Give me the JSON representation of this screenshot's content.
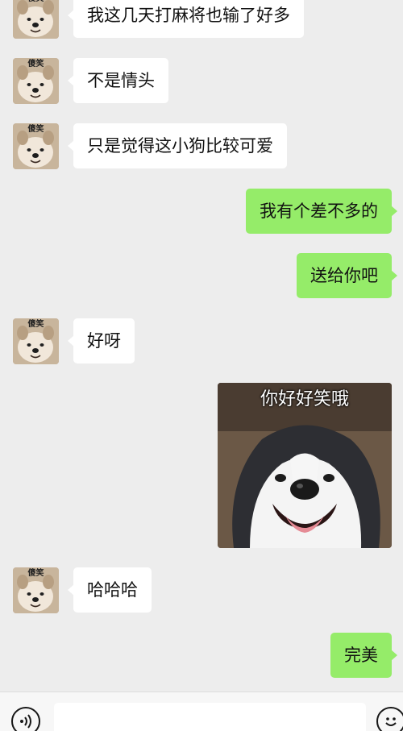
{
  "contact": {
    "avatar_label": "傻笑"
  },
  "messages": [
    {
      "side": "left",
      "text": "我这几天打麻将也输了好多"
    },
    {
      "side": "left",
      "text": "不是情头"
    },
    {
      "side": "left",
      "text": "只是觉得这小狗比较可爱"
    },
    {
      "side": "right",
      "text": "我有个差不多的"
    },
    {
      "side": "right",
      "text": "送给你吧"
    },
    {
      "side": "left",
      "text": "好呀"
    },
    {
      "side": "right",
      "type": "sticker",
      "caption": "你好好笑哦"
    },
    {
      "side": "left",
      "text": "哈哈哈"
    },
    {
      "side": "right",
      "text": "完美"
    }
  ],
  "input_bar": {
    "voice_icon": "voice-icon",
    "emoji_icon": "emoji-icon",
    "input_value": ""
  },
  "colors": {
    "background": "#ededed",
    "sent_bubble": "#95ec69",
    "received_bubble": "#ffffff"
  }
}
